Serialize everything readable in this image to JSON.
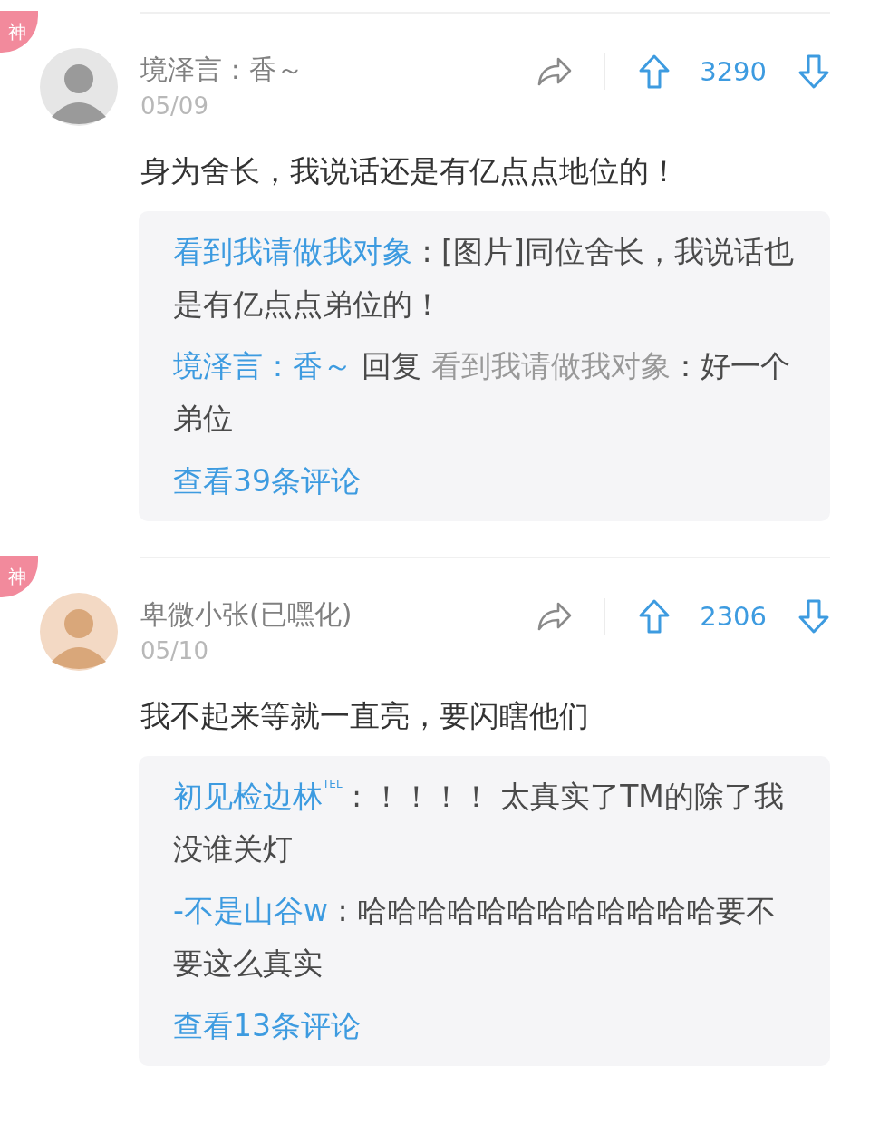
{
  "comments": [
    {
      "badge": "神",
      "author": "境泽言：香～",
      "date": "05/09",
      "votes": "3290",
      "text": "身为舍长，我说话还是有亿点点地位的！",
      "replies": [
        {
          "kind": "direct",
          "author": "看到我请做我对象",
          "text": " : [图片]同位舍长，我说话也是有亿点点弟位的！"
        },
        {
          "kind": "reply",
          "author": "境泽言：香～",
          "reply_word": "回复",
          "reply_to": "看到我请做我对象",
          "text": "：好一个弟位"
        }
      ],
      "more": "查看39条评论"
    },
    {
      "badge": "神",
      "author": "卑微小张(已嘿化)",
      "date": "05/10",
      "votes": "2306",
      "text": "我不起来等就一直亮，要闪瞎他们",
      "replies": [
        {
          "kind": "direct",
          "author": "初见检边林",
          "tag": "TEL",
          "text": " : ！！！！ 太真实了TM的除了我没谁关灯"
        },
        {
          "kind": "direct",
          "author": "-不是山谷w",
          "text": " : 哈哈哈哈哈哈哈哈哈哈哈哈要不要这么真实"
        }
      ],
      "more": "查看13条评论"
    }
  ]
}
